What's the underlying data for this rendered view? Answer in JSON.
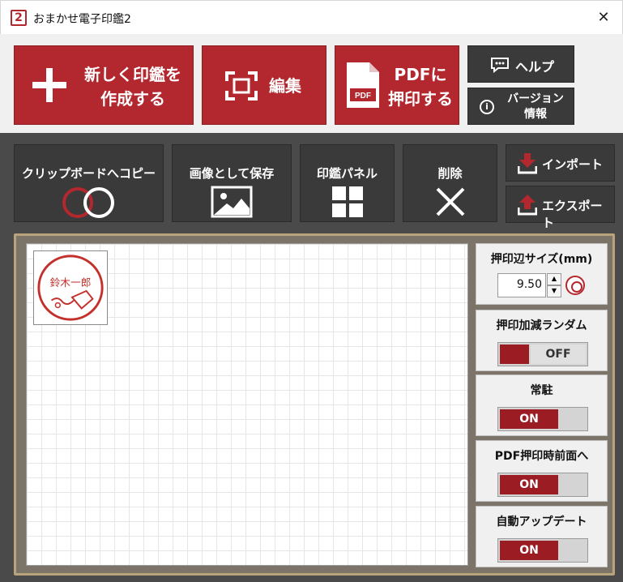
{
  "window": {
    "title": "おまかせ電子印鑑2",
    "icon_text": "2",
    "close_glyph": "✕"
  },
  "toolbar": {
    "new_line1": "新しく印鑑を",
    "new_line2": "作成する",
    "edit": "編集",
    "pdf_line1": "PDFに",
    "pdf_line2": "押印する",
    "pdf_doc_label": "PDF",
    "help": "ヘルプ",
    "version_line1": "バージョン",
    "version_line2": "情報",
    "info_glyph": "i"
  },
  "toolbar2": {
    "clipboard": "クリップボードへコピー",
    "save_image": "画像として保存",
    "stamp_panel": "印鑑パネル",
    "delete": "削除",
    "import": "インポート",
    "export": "エクスポート"
  },
  "canvas": {
    "stamp_name": "鈴木一郎"
  },
  "settings": {
    "size_title": "押印辺サイズ(mm)",
    "size_value": "9.50",
    "random_title": "押印加減ランダム",
    "random_state": "OFF",
    "resident_title": "常駐",
    "resident_state": "ON",
    "pdf_front_title": "PDF押印時前面へ",
    "pdf_front_state": "ON",
    "auto_update_title": "自動アップデート",
    "auto_update_state": "ON"
  },
  "colors": {
    "accent_red": "#b3272e",
    "dark_button": "#3a3a3a",
    "toggle_red": "#9b1c22"
  }
}
